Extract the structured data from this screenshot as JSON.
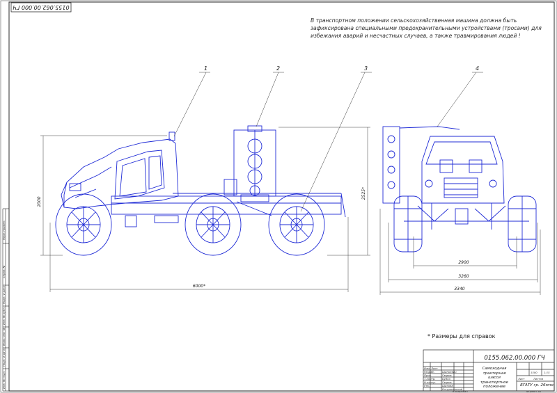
{
  "document_number": "0155.062.00.000 ГЧ",
  "note_text": "В транспортном положении сельскохозяйственная машина должна быть зафиксирована специальными предохранительными устройствами (тросами) для избежания аварий и несчастных случаев, а также травмирования людей !",
  "callouts": [
    "1",
    "2",
    "3",
    "4"
  ],
  "dimensions": {
    "height": "2000",
    "length": "6000*",
    "height_platform": "2525*",
    "track": "2900",
    "width_inner": "3260",
    "width_outer": "3340"
  },
  "reference_note": "* Размеры для справок",
  "title_block": {
    "code": "0155.062.00.000 ГЧ",
    "title_lines": [
      "Самоходная тракторная",
      "шасси",
      "транспортное положение"
    ],
    "mass": "1500",
    "scale": "1:15",
    "org": "БГАТУ гр. 26мпо",
    "sheet": "Лист",
    "sheets": "Листов",
    "row_labels": [
      "Изм. Лист",
      "Разраб.",
      "Пров.",
      "Т.контр.",
      "Н.контр.",
      "Утв."
    ],
    "names": [
      "Шинкевич",
      "Гаврик",
      "Буйко",
      "Гаврик",
      "Шилова",
      "Богдашевский"
    ],
    "copied": "Копировал",
    "format": "Формат А1"
  },
  "side_stamp": [
    "Перв. примен.",
    "Справ. №",
    "Подп. и дата",
    "Инв. № дубл.",
    "Взам. инв. №",
    "Подп. и дата",
    "Инв. № подл."
  ],
  "colors": {
    "lines": "#1f2bd6",
    "frame": "#2b2b2b",
    "dims": "#3a3a3a"
  }
}
